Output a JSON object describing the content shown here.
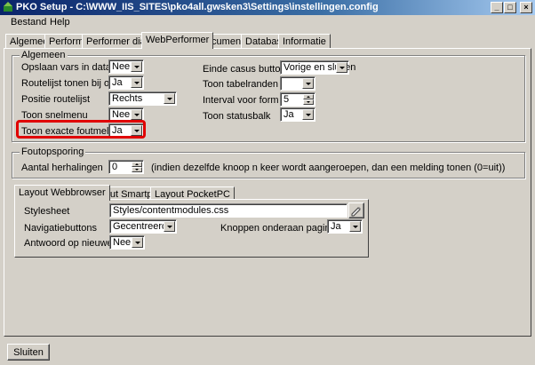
{
  "window": {
    "title": "PKO Setup - C:\\WWW_IIS_SITES\\pko4all.gwsken3\\Settings\\instellingen.config"
  },
  "menu": {
    "bestand": "Bestand",
    "help": "Help"
  },
  "tabs": [
    "Algemeen",
    "Performer",
    "Performer dialoog",
    "WebPerformer",
    "Documenten",
    "Database",
    "Informatie"
  ],
  "active_tab": "WebPerformer",
  "algemeen": {
    "title": "Algemeen",
    "left": [
      {
        "label": "Opslaan vars in database",
        "value": "Nee"
      },
      {
        "label": "Routelijst tonen bij opstart",
        "value": "Ja"
      },
      {
        "label": "Positie routelijst",
        "value": "Rechts"
      },
      {
        "label": "Toon snelmenu",
        "value": "Nee"
      },
      {
        "label": "Toon exacte foutmeldingen",
        "value": "Ja"
      }
    ],
    "right": [
      {
        "label": "Einde casus buttons",
        "value": "Vorige en sluiten"
      },
      {
        "label": "Toon tabelranden",
        "value": ""
      },
      {
        "label": "Interval voor form polling",
        "value": "5"
      },
      {
        "label": "Toon statusbalk",
        "value": "Ja"
      }
    ]
  },
  "foutopsporing": {
    "title": "Foutopsporing",
    "label": "Aantal herhalingen",
    "value": "0",
    "hint": "(indien dezelfde knoop n keer wordt aangeroepen, dan een melding tonen (0=uit))"
  },
  "subtabs": [
    "Layout Webbrowser",
    "Layout Smartphone",
    "Layout PocketPC"
  ],
  "layout": {
    "stylesheet_label": "Stylesheet",
    "stylesheet_value": "Styles/contentmodules.css",
    "nav_label": "Navigatiebuttons",
    "nav_value": "Gecentreerd",
    "knoppen_label": "Knoppen onderaan pagina",
    "knoppen_value": "Ja",
    "antwoord_label": "Antwoord op nieuwe regel",
    "antwoord_value": "Nee"
  },
  "footer": {
    "close_label": "Sluiten"
  }
}
